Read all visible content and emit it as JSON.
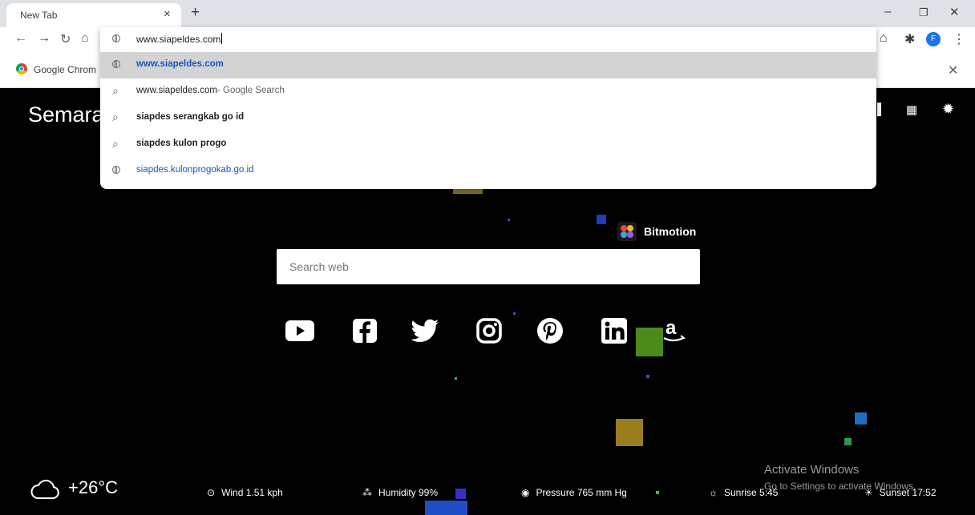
{
  "tab": {
    "title": "New Tab"
  },
  "address": {
    "value": "www.siapeldes.com"
  },
  "bookmarks": {
    "item_label": "Google Chrom"
  },
  "avatar_letter": "F",
  "suggestions": [
    {
      "text": "www.siapeldes.com",
      "icon": "globe-icon",
      "color": "#1a56c4",
      "bold": true
    },
    {
      "text": "www.siapeldes.com",
      "suffix": " - Google Search",
      "icon": "search-icon",
      "color": "#202124",
      "bold": false
    },
    {
      "text": "siapdes serangkab go id",
      "icon": "search-icon",
      "color": "#202124",
      "bold": true
    },
    {
      "text": "siapdes kulon progo",
      "icon": "search-icon",
      "color": "#202124",
      "bold": true
    },
    {
      "text": "siapdes.kulonprogokab.go.id",
      "icon": "globe-icon",
      "color": "#1a56c4",
      "bold": false
    }
  ],
  "page": {
    "city": "Semara",
    "brand": "Bitmotion",
    "search_placeholder": "Search web",
    "social_icons": [
      "youtube-icon",
      "facebook-icon",
      "twitter-icon",
      "instagram-icon",
      "pinterest-icon",
      "linkedin-icon",
      "amazon-icon"
    ]
  },
  "weather": {
    "temperature": "+26°C",
    "wind": "Wind 1.51 kph",
    "humidity": "Humidity 99%",
    "pressure": "Pressure 765 mm Hg",
    "sunrise": "Sunrise 5:45",
    "sunset": "Sunset 17:52"
  },
  "watermark": {
    "line1": "Activate Windows",
    "line2": "Go to Settings to activate Windows."
  }
}
